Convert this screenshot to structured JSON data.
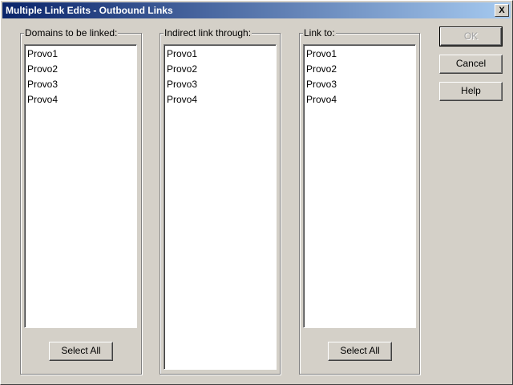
{
  "window": {
    "title": "Multiple Link Edits - Outbound Links",
    "close_label": "X"
  },
  "groups": [
    {
      "label": "Domains to be linked:",
      "items": [
        "Provo1",
        "Provo2",
        "Provo3",
        "Provo4"
      ],
      "select_all": "Select All"
    },
    {
      "label": "Indirect link through:",
      "items": [
        "Provo1",
        "Provo2",
        "Provo3",
        "Provo4"
      ]
    },
    {
      "label": "Link to:",
      "items": [
        "Provo1",
        "Provo2",
        "Provo3",
        "Provo4"
      ],
      "select_all": "Select All"
    }
  ],
  "buttons": {
    "ok": "OK",
    "cancel": "Cancel",
    "help": "Help"
  }
}
